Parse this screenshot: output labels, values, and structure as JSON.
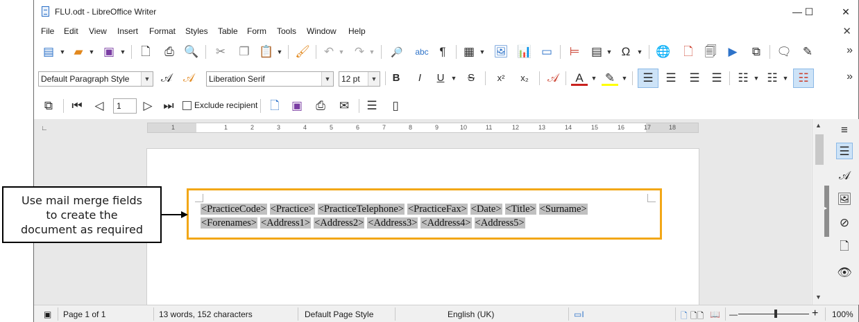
{
  "window": {
    "title": "FLU.odt - LibreOffice Writer",
    "minimize": "—",
    "maximize": "☐",
    "close": "✕"
  },
  "menu": [
    "File",
    "Edit",
    "View",
    "Insert",
    "Format",
    "Styles",
    "Table",
    "Form",
    "Tools",
    "Window",
    "Help"
  ],
  "menu_close": "✕",
  "toolbar2": {
    "paragraph_style": "Default Paragraph Style",
    "font_name": "Liberation Serif",
    "font_size": "12 pt"
  },
  "mailmerge": {
    "record": "1",
    "exclude_recipient": "Exclude recipient"
  },
  "ruler": {
    "labels": [
      "1",
      "1",
      "2",
      "3",
      "4",
      "5",
      "6",
      "7",
      "8",
      "9",
      "10",
      "11",
      "12",
      "13",
      "14",
      "15",
      "16",
      "17",
      "18"
    ]
  },
  "document": {
    "line1": [
      "<PracticeCode>",
      "<Practice>",
      "<PracticeTelephone>",
      "<PracticeFax>",
      "<Date>",
      "<Title>",
      "<Surname>"
    ],
    "line2": [
      "<Forenames>",
      "<Address1>",
      "<Address2>",
      "<Address3>",
      "<Address4>",
      "<Address5>"
    ]
  },
  "callout": {
    "lines": [
      "Use mail merge fields",
      "to create the",
      "document as required"
    ]
  },
  "status": {
    "page": "Page 1 of 1",
    "words": "13 words, 152 characters",
    "page_style": "Default Page Style",
    "language": "English (UK)",
    "zoom": "100%"
  },
  "colors": {
    "highlight_box": "#f2a717",
    "field_shading": "#c0c0c0",
    "selected_button": "#cde3f7"
  }
}
